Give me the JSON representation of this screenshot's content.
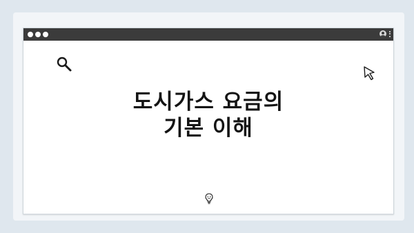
{
  "card": {
    "headline_line1": "도시가스 요금의",
    "headline_line2": "기본 이해"
  },
  "icons": {
    "search": "search-icon",
    "cursor": "cursor-icon",
    "bulb": "lightbulb-icon",
    "avatar": "user-icon",
    "menu": "more-vertical-icon"
  },
  "colors": {
    "background": "#dfe7ee",
    "titlebar": "#3b3b3b",
    "window": "#ffffff",
    "text": "#141414"
  }
}
